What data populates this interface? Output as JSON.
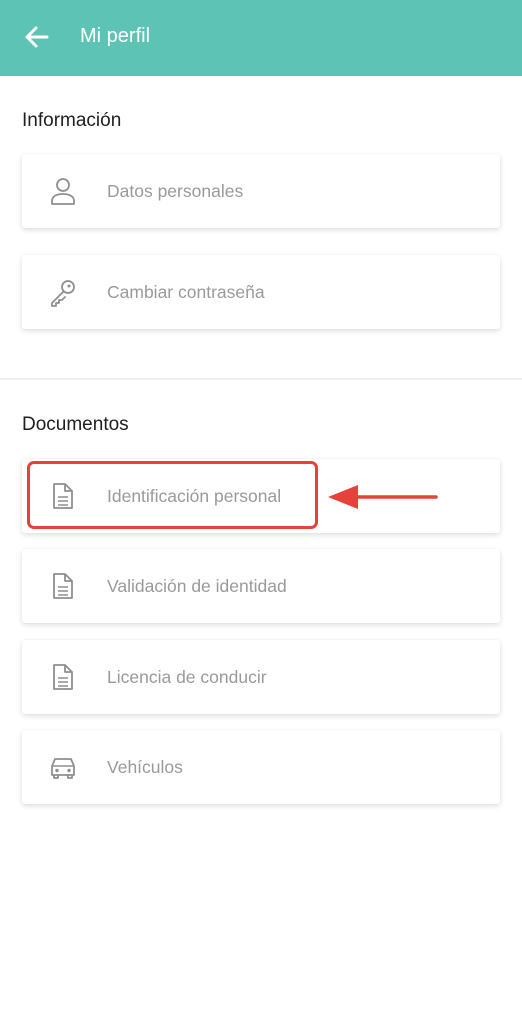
{
  "header": {
    "title": "Mi perfil",
    "back_icon": "arrow-left-icon",
    "background_color": "#5dc4b5"
  },
  "info_section": {
    "title": "Información",
    "items": [
      {
        "label": "Datos personales",
        "icon": "user-icon"
      },
      {
        "label": "Cambiar contraseña",
        "icon": "key-icon"
      }
    ]
  },
  "documents_section": {
    "title": "Documentos",
    "items": [
      {
        "label": "Identificación personal",
        "icon": "document-icon"
      },
      {
        "label": "Validación de identidad",
        "icon": "document-icon"
      },
      {
        "label": "Licencia de conducir",
        "icon": "document-icon"
      },
      {
        "label": "Vehículos",
        "icon": "car-icon"
      }
    ]
  },
  "annotation": {
    "highlight_color": "#e8413b"
  }
}
